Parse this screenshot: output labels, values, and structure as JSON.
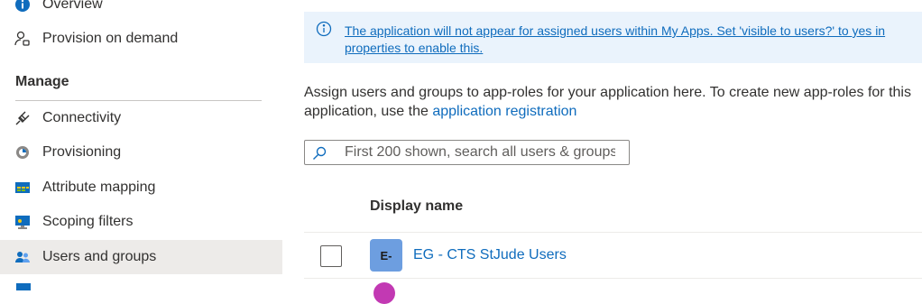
{
  "sidebar": {
    "items_top": [
      {
        "label": "Overview",
        "icon": "info-icon"
      },
      {
        "label": "Provision on demand",
        "icon": "person-provision-icon"
      }
    ],
    "section_heading": "Manage",
    "items": [
      {
        "label": "Connectivity",
        "icon": "plug-icon"
      },
      {
        "label": "Provisioning",
        "icon": "provisioning-icon"
      },
      {
        "label": "Attribute mapping",
        "icon": "table-icon"
      },
      {
        "label": "Scoping filters",
        "icon": "monitor-icon"
      },
      {
        "label": "Users and groups",
        "icon": "people-icon",
        "selected": true
      }
    ]
  },
  "banner": {
    "message": "The application will not appear for assigned users within My Apps. Set 'visible to users?' to yes in properties to enable this."
  },
  "description": {
    "text": "Assign users and groups to app-roles for your application here. To create new app-roles for this application, use the",
    "link": "application registration"
  },
  "search": {
    "placeholder": "First 200 shown, search all users & groups"
  },
  "table": {
    "column_header": "Display name",
    "rows": [
      {
        "initials": "E-",
        "name": "EG - CTS StJude Users"
      }
    ]
  },
  "colors": {
    "accent": "#0f6cbd",
    "banner_bg": "#eaf3fc",
    "selected_bg": "#edebe9",
    "avatar_bg": "#6d9ee0"
  }
}
